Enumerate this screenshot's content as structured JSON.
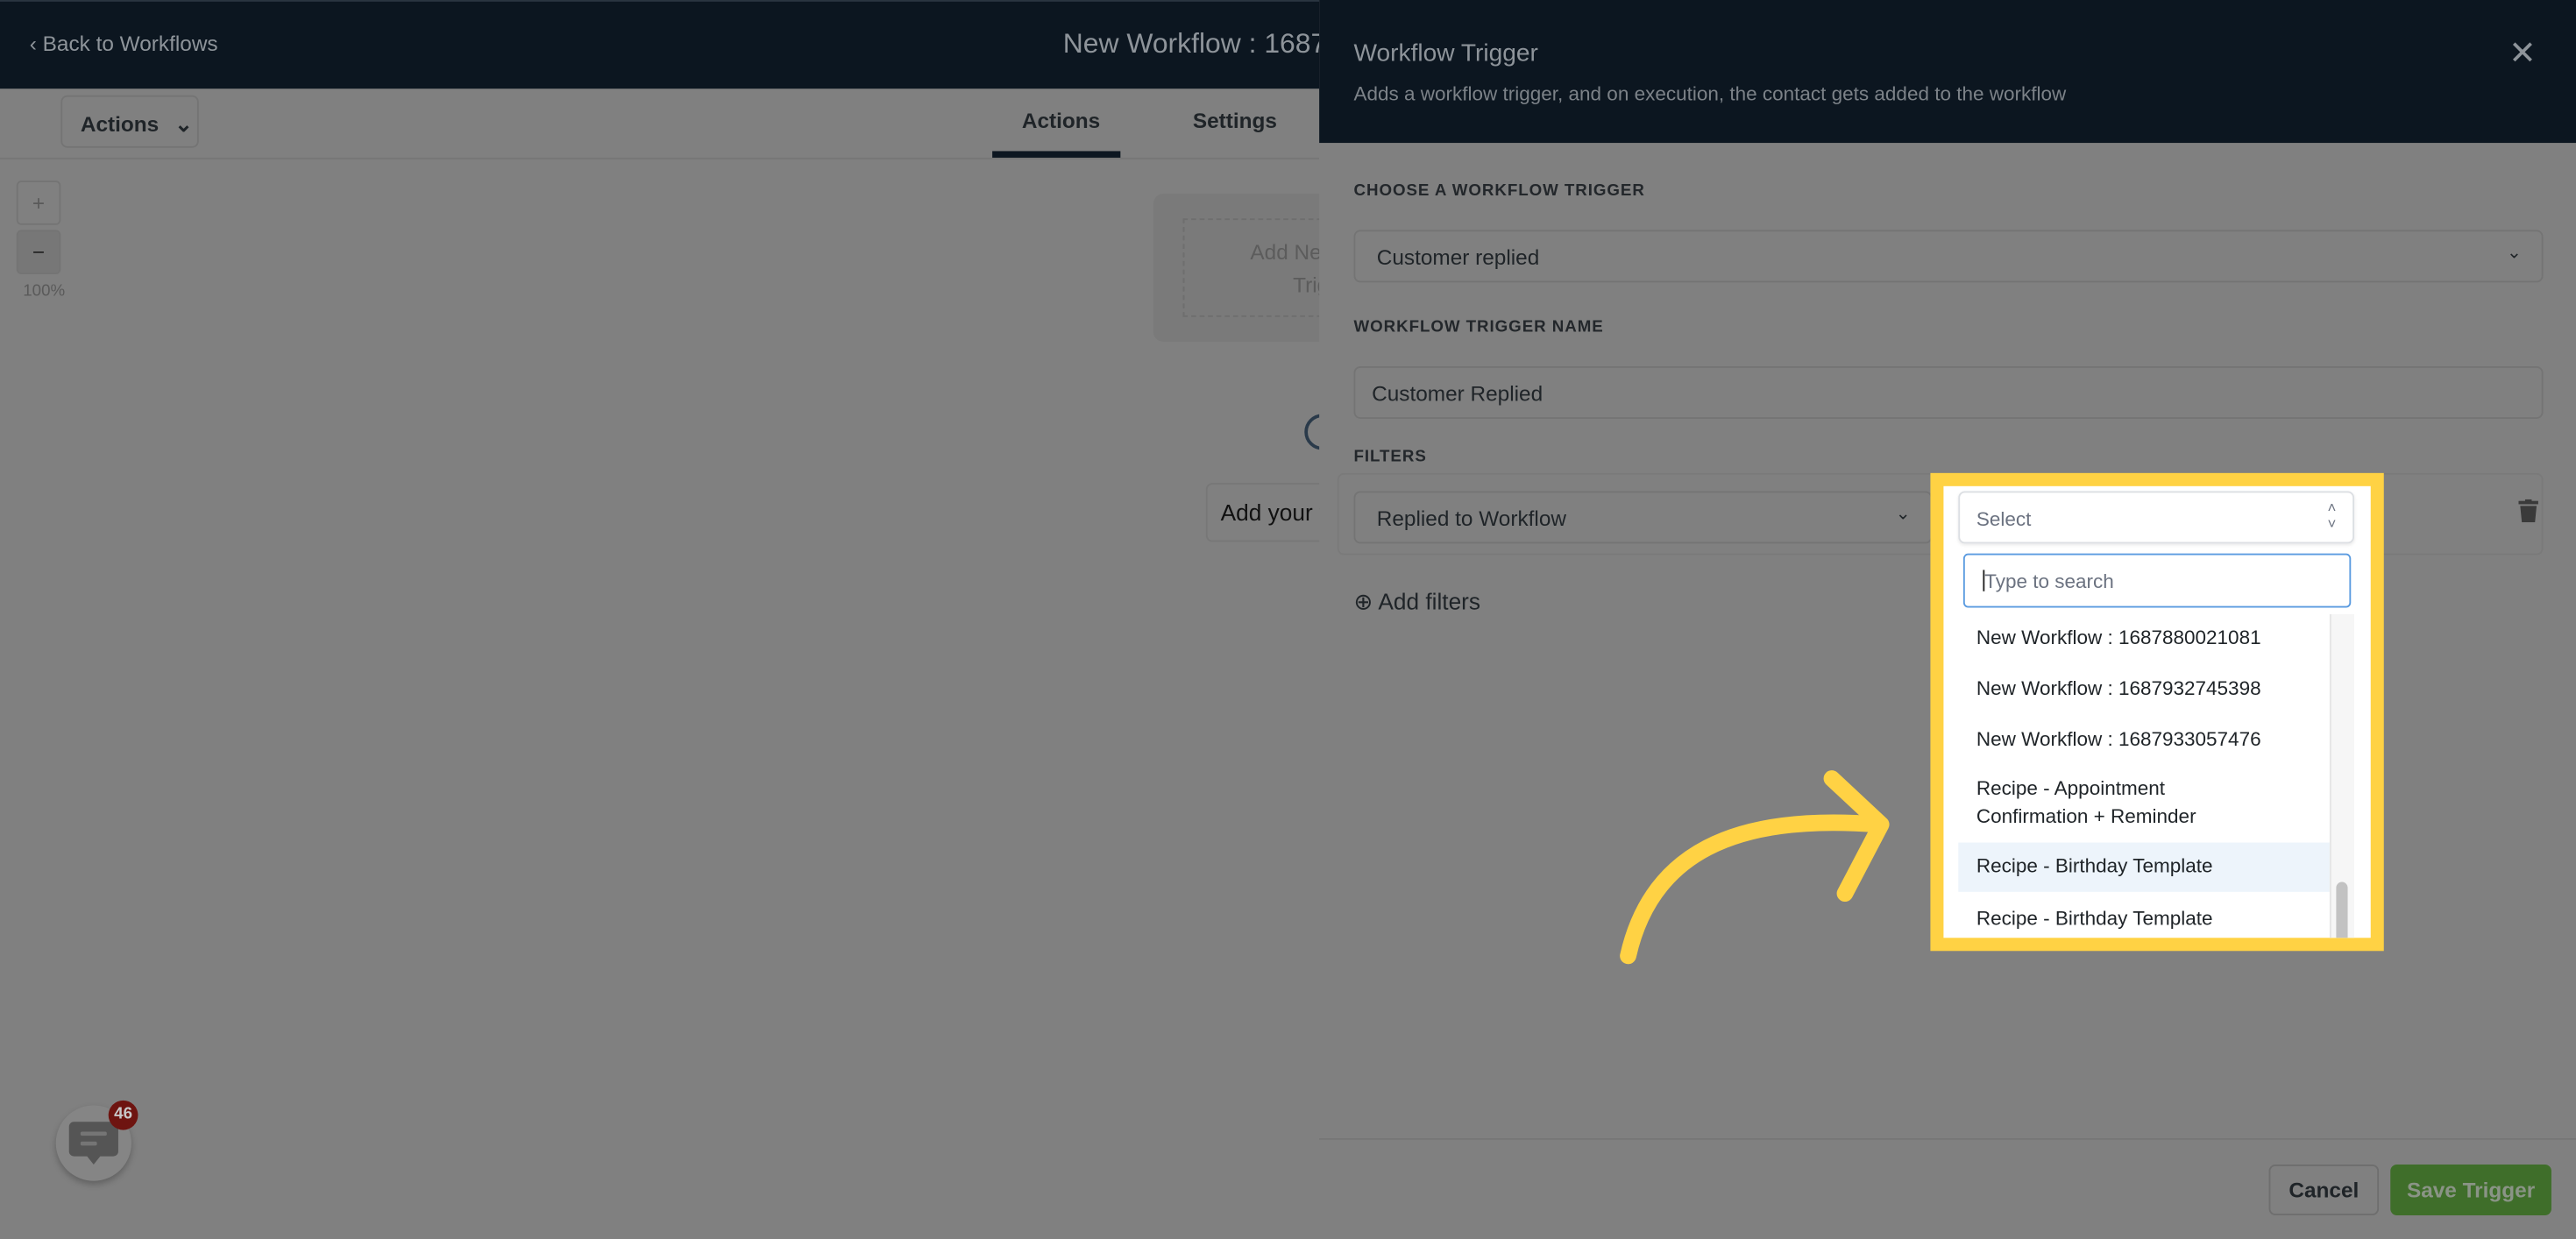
{
  "header": {
    "back_label": "Back to Workflows",
    "title": "New Workflow : 1687"
  },
  "toolbar": {
    "actions_dropdown": "Actions",
    "tabs": [
      {
        "label": "Actions",
        "active": true
      },
      {
        "label": "Settings",
        "active": false
      }
    ]
  },
  "zoom": {
    "plus": "+",
    "minus": "−",
    "level": "100%"
  },
  "canvas": {
    "trigger_node_line1": "Add New",
    "trigger_node_line2": "Trig",
    "add_action_text": "Add your t"
  },
  "panel": {
    "title": "Workflow Trigger",
    "subtitle": "Adds a workflow trigger, and on execution, the contact gets added to the workflow",
    "choose_label": "CHOOSE A WORKFLOW TRIGGER",
    "trigger_value": "Customer replied",
    "name_label": "WORKFLOW TRIGGER NAME",
    "name_value": "Customer Replied",
    "filters_label": "FILTERS",
    "filter_field": "Replied to Workflow",
    "filter_value_placeholder": "Select",
    "search_placeholder": "Type to search",
    "options": [
      {
        "label": "New Workflow : 1687880021081"
      },
      {
        "label": "New Workflow : 1687932745398"
      },
      {
        "label": "New Workflow : 1687933057476"
      },
      {
        "label": "Recipe - Appointment Confirmation + Reminder"
      },
      {
        "label": "Recipe - Birthday Template",
        "hovered": true
      },
      {
        "label": "Recipe - Birthday Template"
      }
    ],
    "add_filters": "Add filters",
    "cancel": "Cancel",
    "save": "Save Trigger"
  },
  "chat": {
    "unread_count": "46"
  },
  "colors": {
    "header": "#0c1620",
    "highlight": "#ffd244",
    "save_button": "#3f6e2a",
    "focus": "#5b9be0",
    "badge": "#6e1410"
  }
}
